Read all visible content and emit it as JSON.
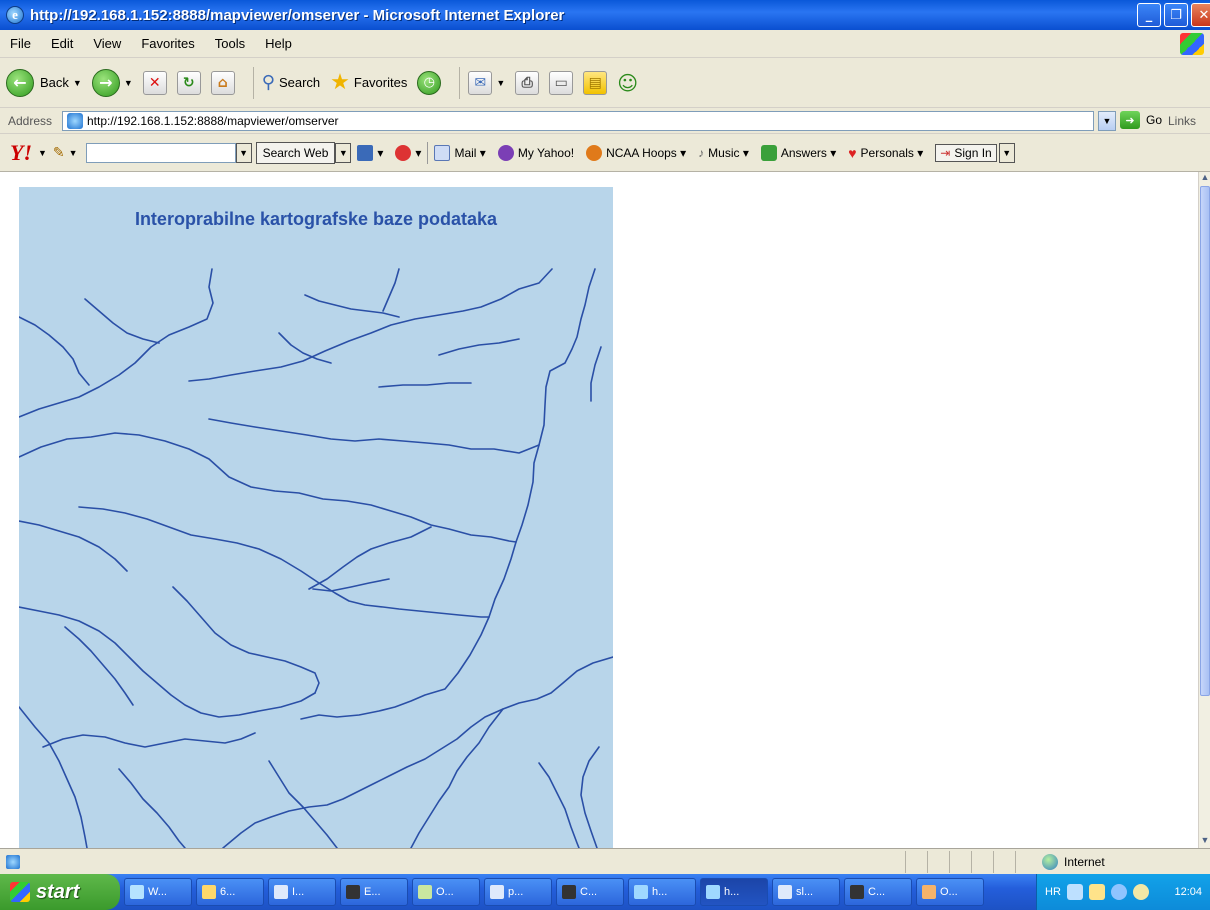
{
  "window": {
    "title": "http://192.168.1.152:8888/mapviewer/omserver - Microsoft Internet Explorer"
  },
  "menu": [
    "File",
    "Edit",
    "View",
    "Favorites",
    "Tools",
    "Help"
  ],
  "toolbar": {
    "back_label": "Back",
    "search_label": "Search",
    "favorites_label": "Favorites"
  },
  "address": {
    "label": "Address",
    "url": "http://192.168.1.152:8888/mapviewer/omserver",
    "go_label": "Go",
    "links_label": "Links"
  },
  "yahoo": {
    "logo": "Y!",
    "search_btn": "Search Web",
    "items": [
      "Mail",
      "My Yahoo!",
      "NCAA Hoops",
      "Music",
      "Answers",
      "Personals"
    ],
    "signin": "Sign In"
  },
  "map": {
    "title": "Interoprabilne kartografske baze podataka"
  },
  "status": {
    "zone": "Internet"
  },
  "taskbar": {
    "start_label": "start",
    "tasks": [
      "W...",
      "6...",
      "I...",
      "E...",
      "O...",
      "p...",
      "C...",
      "h...",
      "h...",
      "sl...",
      "C...",
      "O..."
    ],
    "tray_lang": "HR",
    "clock": "12:04"
  },
  "colors": {
    "map_bg": "#b8d5ea",
    "river": "#2a4fa6",
    "title_text": "#2a52a8"
  }
}
